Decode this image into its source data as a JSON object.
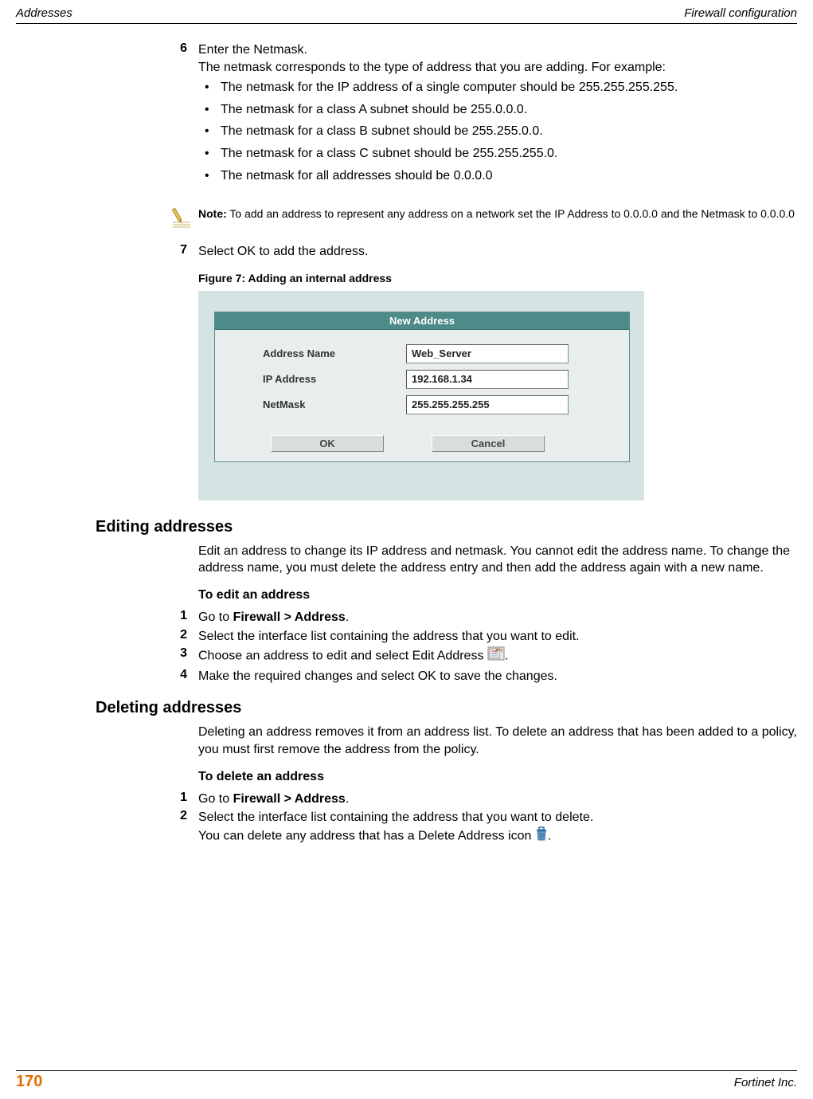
{
  "header": {
    "left": "Addresses",
    "right": "Firewall configuration"
  },
  "step6": {
    "num": "6",
    "line1": "Enter the Netmask.",
    "line2": "The netmask corresponds to the type of address that you are adding. For example:",
    "bullets": [
      "The netmask for the IP address of a single computer should be 255.255.255.255.",
      "The netmask for a class A subnet should be 255.0.0.0.",
      "The netmask for a class B subnet should be 255.255.0.0.",
      "The netmask for a class C subnet should be 255.255.255.0.",
      "The netmask for all addresses should be 0.0.0.0"
    ]
  },
  "note": {
    "label": "Note:",
    "text": " To add an address to represent any address on a network set the IP Address to 0.0.0.0 and the Netmask to 0.0.0.0"
  },
  "step7": {
    "num": "7",
    "text": "Select OK to add the address."
  },
  "figure": {
    "caption": "Figure 7:   Adding an internal address",
    "title": "New Address",
    "rows": {
      "name": {
        "label": "Address Name",
        "value": "Web_Server"
      },
      "ip": {
        "label": "IP Address",
        "value": "192.168.1.34"
      },
      "mask": {
        "label": "NetMask",
        "value": "255.255.255.255"
      }
    },
    "buttons": {
      "ok": "OK",
      "cancel": "Cancel"
    }
  },
  "editing": {
    "heading": "Editing addresses",
    "para": "Edit an address to change its IP address and netmask. You cannot edit the address name. To change the address name, you must delete the address entry and then add the address again with a new name.",
    "sub": "To edit an address",
    "steps": {
      "s1": {
        "num": "1",
        "pre": "Go to ",
        "bold": "Firewall > Address",
        "post": "."
      },
      "s2": {
        "num": "2",
        "text": "Select the interface list containing the address that you want to edit."
      },
      "s3": {
        "num": "3",
        "pre": "Choose an address to edit and select Edit Address ",
        "post": "."
      },
      "s4": {
        "num": "4",
        "text": "Make the required changes and select OK to save the changes."
      }
    }
  },
  "deleting": {
    "heading": "Deleting addresses",
    "para": "Deleting an address removes it from an address list. To delete an address that has been added to a policy, you must first remove the address from the policy.",
    "sub": "To delete an address",
    "steps": {
      "s1": {
        "num": "1",
        "pre": "Go to ",
        "bold": "Firewall > Address",
        "post": "."
      },
      "s2": {
        "num": "2",
        "line1": "Select the interface list containing the address that you want to delete.",
        "line2pre": "You can delete any address that has a Delete Address icon ",
        "line2post": "."
      }
    }
  },
  "footer": {
    "page": "170",
    "right": "Fortinet Inc."
  }
}
